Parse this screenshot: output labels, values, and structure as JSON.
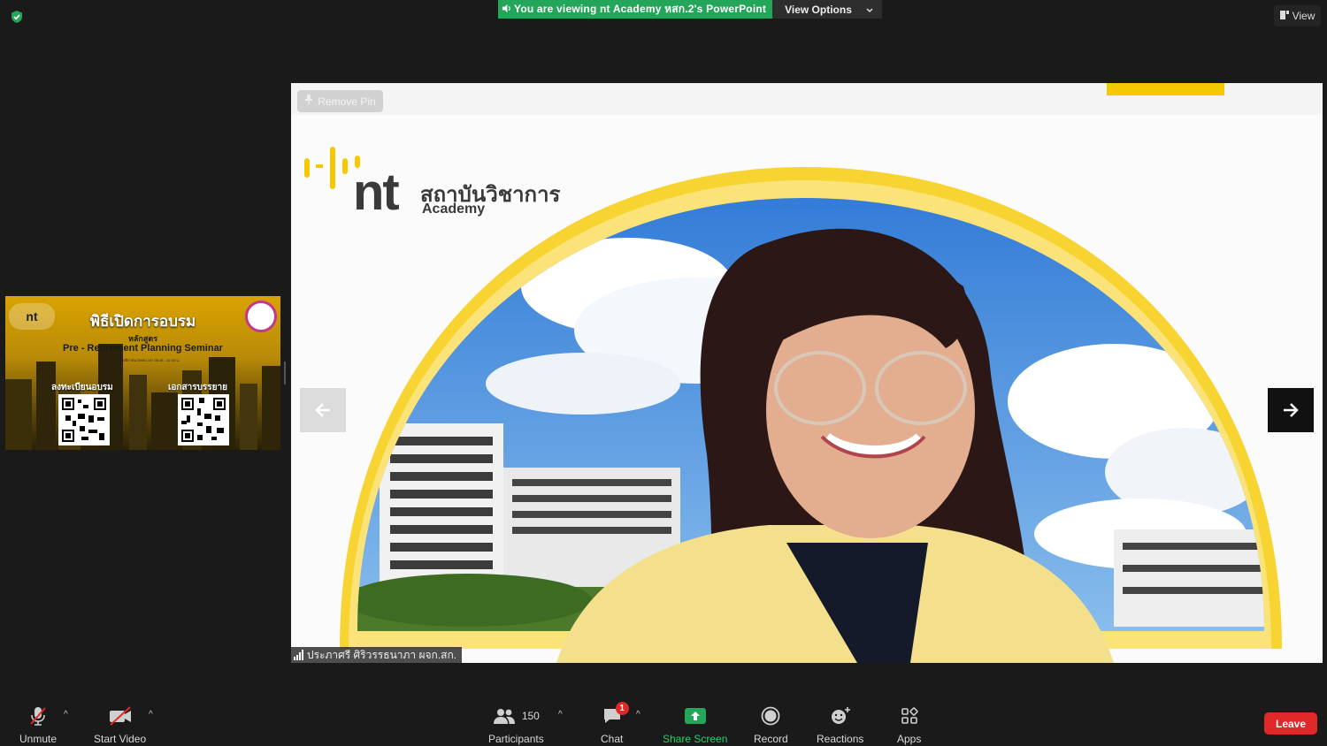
{
  "top": {
    "share_banner": "You are viewing nt Academy หสก.2's PowerPoint",
    "view_options": "View Options",
    "view_label": "View"
  },
  "thumbnail": {
    "logo": "nt",
    "title": "พิธีเปิดการอบรม",
    "course_label": "หลักสูตร",
    "course_name": "Pre - Retirement Planning Seminar",
    "date_line": "วันที่ 20 พฤศจิกายน 2566 เวลา 08.45 - 12.00 น.",
    "qr_left_label": "ลงทะเบียนอบรม",
    "qr_right_label": "เอกสารบรรยาย"
  },
  "video": {
    "remove_pin": "Remove Pin",
    "brand_thai": "สถาบันวิชาการ",
    "brand_en": "Academy",
    "brand_logo": "nt",
    "participant_name": "ประภาศรี ศิริวรรธนาภา ผจก.สก.",
    "prev_icon": "arrow-left-icon",
    "next_icon": "arrow-right-icon"
  },
  "toolbar": {
    "unmute": "Unmute",
    "start_video": "Start Video",
    "participants": "Participants",
    "participant_count": "150",
    "chat": "Chat",
    "chat_badge": "1",
    "share_screen": "Share Screen",
    "record": "Record",
    "reactions": "Reactions",
    "apps": "Apps",
    "leave": "Leave"
  },
  "colors": {
    "share_green": "#23a659",
    "leave_red": "#e02828",
    "background": "#1a1a1a",
    "brand_yellow": "#f6c800"
  }
}
